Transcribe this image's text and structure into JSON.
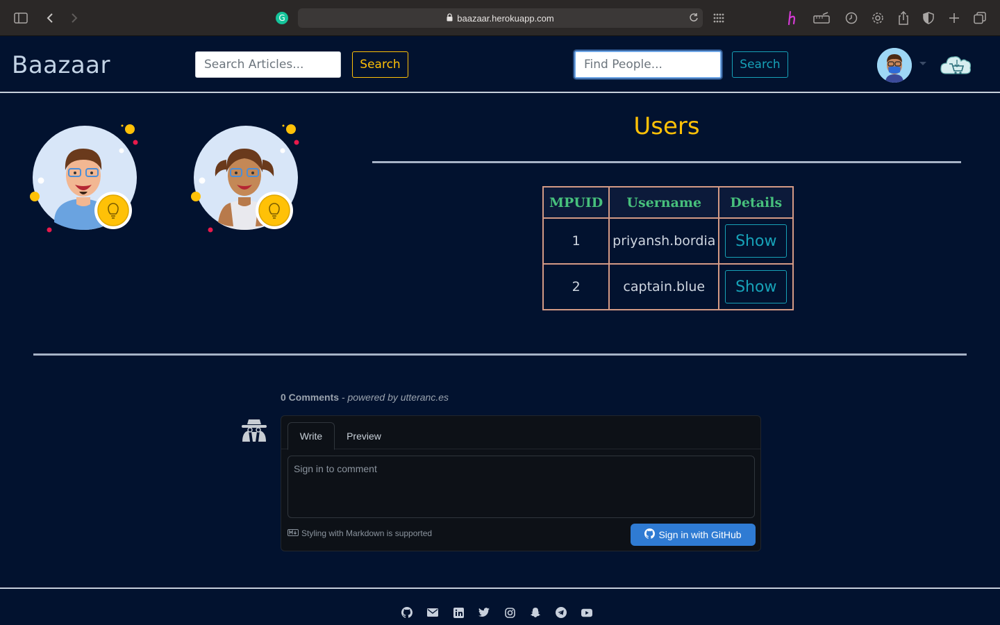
{
  "browser": {
    "url": "baazaar.herokuapp.com"
  },
  "navbar": {
    "brand": "Baazaar",
    "article_search_placeholder": "Search Articles...",
    "article_search_button": "Search",
    "people_search_placeholder": "Find People...",
    "people_search_button": "Search"
  },
  "users": {
    "title": "Users",
    "columns": [
      "MPUID",
      "Username",
      "Details"
    ],
    "rows": [
      {
        "id": "1",
        "username": "priyansh.bordia",
        "action": "Show"
      },
      {
        "id": "2",
        "username": "captain.blue",
        "action": "Show"
      }
    ]
  },
  "comments": {
    "count_label": "0 Comments",
    "powered_by": " - powered by utteranc.es",
    "tab_write": "Write",
    "tab_preview": "Preview",
    "placeholder": "Sign in to comment",
    "markdown_note": "Styling with Markdown is supported",
    "signin_button": "Sign in with GitHub"
  },
  "footer": {
    "icons": [
      "github-icon",
      "mail-icon",
      "linkedin-icon",
      "twitter-icon",
      "instagram-icon",
      "snapchat-icon",
      "telegram-icon",
      "youtube-icon"
    ]
  },
  "colors": {
    "background": "#02122f",
    "accent_yellow": "#ffc107",
    "accent_cyan": "#17a2b8",
    "table_header_text": "#47c07c",
    "table_border": "#d49a85",
    "github_button": "#2f7bd3"
  }
}
